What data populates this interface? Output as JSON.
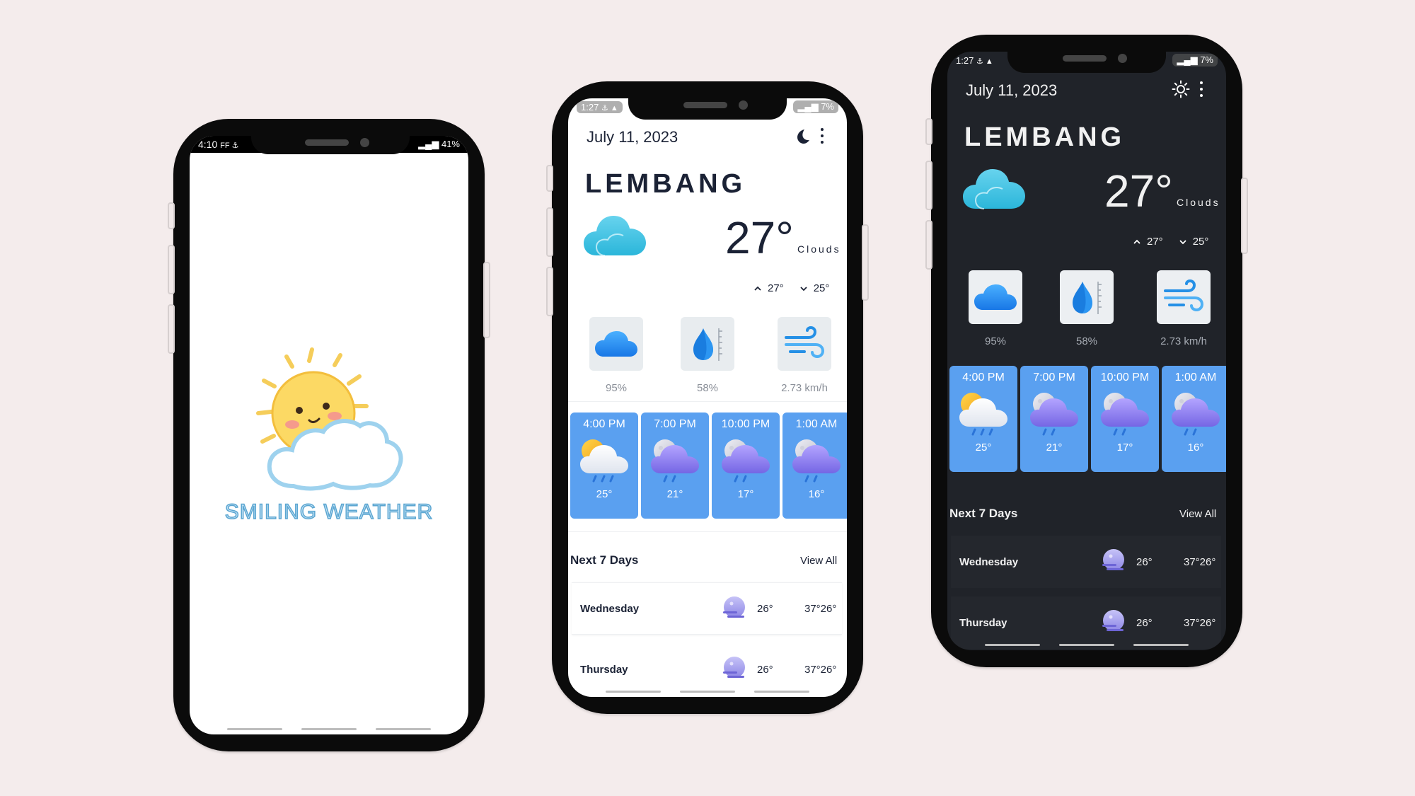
{
  "colors": {
    "background": "#f4ecec",
    "card_blue": "#5aa0f0",
    "dark_bg": "#202329"
  },
  "splash": {
    "status": {
      "time": "4:10",
      "icons_left": "FF ⚓",
      "battery": "41%"
    },
    "app_name": "SMILING WEATHER"
  },
  "light": {
    "status": {
      "time": "1:27",
      "icons_left": "⚓ ▲",
      "battery": "7%"
    },
    "date": "July 11, 2023",
    "theme_icon": "moon-icon",
    "city": "LEMBANG",
    "temperature": "27°",
    "condition": "Clouds",
    "high": "27°",
    "low": "25°",
    "stats": [
      {
        "icon": "cloud-icon",
        "value": "95%"
      },
      {
        "icon": "humidity-drop-icon",
        "value": "58%"
      },
      {
        "icon": "wind-icon",
        "value": "2.73 km/h"
      }
    ],
    "hourly": [
      {
        "time": "4:00 PM",
        "temp": "25°",
        "icon": "sun-cloud-rain-icon"
      },
      {
        "time": "7:00 PM",
        "temp": "21°",
        "icon": "moon-cloud-rain-icon"
      },
      {
        "time": "10:00 PM",
        "temp": "17°",
        "icon": "moon-cloud-rain-icon"
      },
      {
        "time": "1:00 AM",
        "temp": "16°",
        "icon": "moon-cloud-rain-icon"
      }
    ],
    "next_title": "Next 7 Days",
    "view_all": "View All",
    "days": [
      {
        "name": "Wednesday",
        "temp": "26°",
        "range": "37°26°"
      },
      {
        "name": "Thursday",
        "temp": "26°",
        "range": "37°26°"
      }
    ]
  },
  "dark": {
    "status": {
      "time": "1:27",
      "icons_left": "⚓ ▲",
      "battery": "7%"
    },
    "date": "July 11, 2023",
    "theme_icon": "sun-icon",
    "city": "LEMBANG",
    "temperature": "27°",
    "condition": "Clouds",
    "high": "27°",
    "low": "25°",
    "stats": [
      {
        "icon": "cloud-icon",
        "value": "95%"
      },
      {
        "icon": "humidity-drop-icon",
        "value": "58%"
      },
      {
        "icon": "wind-icon",
        "value": "2.73 km/h"
      }
    ],
    "hourly": [
      {
        "time": "4:00 PM",
        "temp": "25°",
        "icon": "sun-cloud-rain-icon"
      },
      {
        "time": "7:00 PM",
        "temp": "21°",
        "icon": "moon-cloud-rain-icon"
      },
      {
        "time": "10:00 PM",
        "temp": "17°",
        "icon": "moon-cloud-rain-icon"
      },
      {
        "time": "1:00 AM",
        "temp": "16°",
        "icon": "moon-cloud-rain-icon"
      }
    ],
    "next_title": "Next 7 Days",
    "view_all": "View All",
    "days": [
      {
        "name": "Wednesday",
        "temp": "26°",
        "range": "37°26°"
      },
      {
        "name": "Thursday",
        "temp": "26°",
        "range": "37°26°"
      }
    ]
  }
}
